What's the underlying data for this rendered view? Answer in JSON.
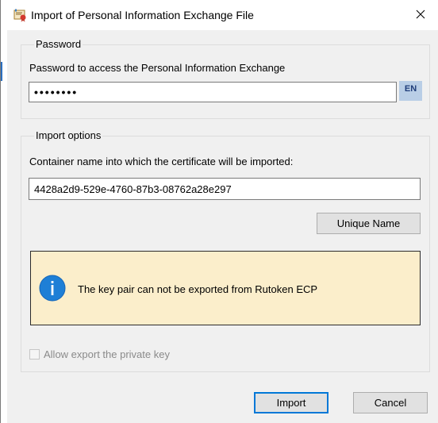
{
  "window": {
    "title": "Import of Personal Information Exchange File",
    "close_icon": "close-icon",
    "app_icon": "certificate-app-icon"
  },
  "password_group": {
    "label": "Password",
    "field_label": "Password to access the Personal Information Exchange",
    "masked_value": "••••••••",
    "language_indicator": "EN"
  },
  "import_options": {
    "label": "Import options",
    "container_label": "Container name into which the certificate will be imported:",
    "container_value": "4428a2d9-529e-4760-87b3-08762a28e297",
    "unique_name_button": "Unique Name",
    "info_message": "The key pair can not be exported from Rutoken ECP",
    "info_icon": "info-icon",
    "info_background": "#fbeecb",
    "allow_export_label": "Allow export the private key",
    "allow_export_checked": false,
    "allow_export_enabled": false
  },
  "buttons": {
    "import": "Import",
    "cancel": "Cancel"
  },
  "colors": {
    "accent": "#0078d7",
    "dialog_background": "#f0f0f0",
    "info_icon": "#1e7fd6"
  }
}
